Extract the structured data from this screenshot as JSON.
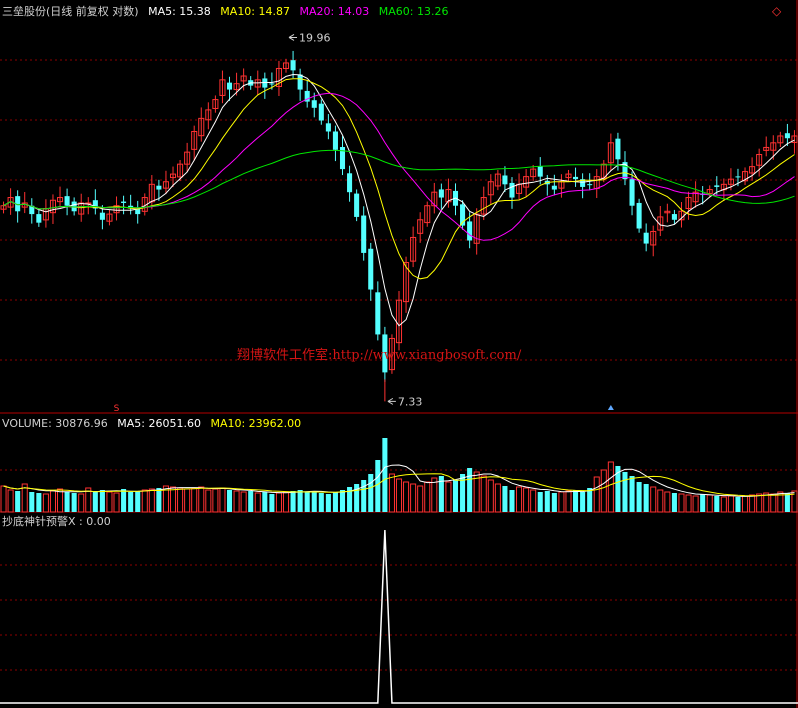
{
  "header": {
    "title": "三垒股份(日线 前复权 对数)",
    "ma5": "MA5: 15.38",
    "ma10": "MA10: 14.87",
    "ma20": "MA20: 14.03",
    "ma60": "MA60: 13.26"
  },
  "volume_header": {
    "volume": "VOLUME: 30876.96",
    "ma5": "MA5: 26051.60",
    "ma10": "MA10: 23962.00"
  },
  "indicator_header": {
    "label": "抄底神针预警X : 0.00"
  },
  "watermark": "翔博软件工作室:http://www.xiangbosoft.com/",
  "markers": {
    "high_label": "19.96",
    "low_label": "7.33",
    "sell_mark": "S"
  },
  "colors": {
    "background": "#000000",
    "up": "#ff3232",
    "down": "#54ffff",
    "ma5": "#ffffff",
    "ma10": "#ffff00",
    "ma20": "#ff00ff",
    "ma60": "#00e600",
    "grid": "#8b0000",
    "divider": "#b40000",
    "indicator": "#ffffff",
    "title": "#d0d0d0"
  },
  "chart_data": [
    {
      "type": "candlestick",
      "ylim": [
        7.0,
        21.5
      ],
      "log_scale": true,
      "series": [
        {
          "name": "MA5",
          "value": 15.38
        },
        {
          "name": "MA10",
          "value": 14.87
        },
        {
          "name": "MA20",
          "value": 14.03
        },
        {
          "name": "MA60",
          "value": 13.26
        }
      ],
      "close": [
        12.6,
        12.9,
        12.4,
        12.7,
        12.3,
        12.0,
        12.5,
        12.8,
        12.9,
        12.6,
        12.4,
        12.7,
        12.7,
        12.5,
        12.1,
        12.3,
        12.6,
        12.7,
        12.5,
        12.3,
        12.9,
        13.4,
        13.2,
        13.5,
        13.8,
        14.2,
        14.7,
        15.6,
        16.2,
        16.6,
        17.1,
        18.1,
        17.6,
        17.9,
        18.3,
        17.8,
        18.1,
        17.7,
        17.9,
        18.7,
        19.0,
        18.6,
        17.6,
        17.0,
        16.7,
        16.1,
        15.6,
        14.8,
        14.0,
        13.1,
        12.2,
        11.0,
        9.9,
        8.7,
        7.8,
        8.6,
        9.6,
        10.7,
        11.5,
        12.1,
        12.6,
        13.1,
        12.9,
        13.2,
        12.6,
        11.9,
        11.4,
        12.3,
        12.9,
        13.5,
        13.8,
        13.4,
        12.9,
        13.4,
        13.7,
        14.0,
        13.7,
        13.4,
        13.2,
        13.5,
        13.8,
        13.6,
        13.3,
        13.4,
        13.7,
        14.2,
        15.1,
        14.4,
        13.6,
        12.6,
        11.8,
        11.3,
        11.7,
        12.2,
        12.4,
        12.1,
        12.4,
        12.9,
        13.1,
        13.0,
        13.2,
        13.3,
        13.4,
        13.6,
        13.7,
        13.9,
        14.1,
        14.6,
        14.9,
        15.1,
        15.4,
        15.3,
        15.4
      ],
      "volume": {
        "series": [
          {
            "name": "VOLUME",
            "value": 30876.96
          },
          {
            "name": "MA5",
            "value": 26051.6
          },
          {
            "name": "MA10",
            "value": 23962.0
          }
        ],
        "ylim": [
          0,
          80000
        ],
        "values": [
          26000,
          22000,
          21000,
          28000,
          20000,
          19000,
          18000,
          21000,
          23000,
          20000,
          19000,
          18000,
          24000,
          21000,
          22000,
          20000,
          19000,
          23000,
          20000,
          21000,
          22000,
          23000,
          24000,
          26000,
          25000,
          24000,
          23000,
          24000,
          25000,
          22000,
          23000,
          24000,
          22000,
          21000,
          20000,
          21000,
          19000,
          20000,
          18000,
          19000,
          20000,
          21000,
          22000,
          20000,
          21000,
          19000,
          18000,
          20000,
          22000,
          25000,
          28000,
          32000,
          38000,
          52000,
          74000,
          38000,
          33000,
          30000,
          28000,
          26000,
          30000,
          34000,
          36000,
          30000,
          32000,
          38000,
          44000,
          40000,
          36000,
          32000,
          28000,
          26000,
          22000,
          25000,
          24000,
          22000,
          20000,
          21000,
          19000,
          20000,
          21000,
          22000,
          20000,
          24000,
          35000,
          42000,
          50000,
          46000,
          40000,
          36000,
          30000,
          28000,
          25000,
          22000,
          20000,
          19000,
          18000,
          17000,
          16000,
          18000,
          17000,
          16000,
          15000,
          16000,
          15000,
          16000,
          17000,
          18000,
          19000,
          18000,
          20000,
          19000,
          21000
        ]
      },
      "indicator": {
        "name": "抄底神针预警X",
        "value": 0.0,
        "ylim": [
          0,
          1
        ],
        "spike_index": 54,
        "spike_value": 1
      }
    }
  ]
}
